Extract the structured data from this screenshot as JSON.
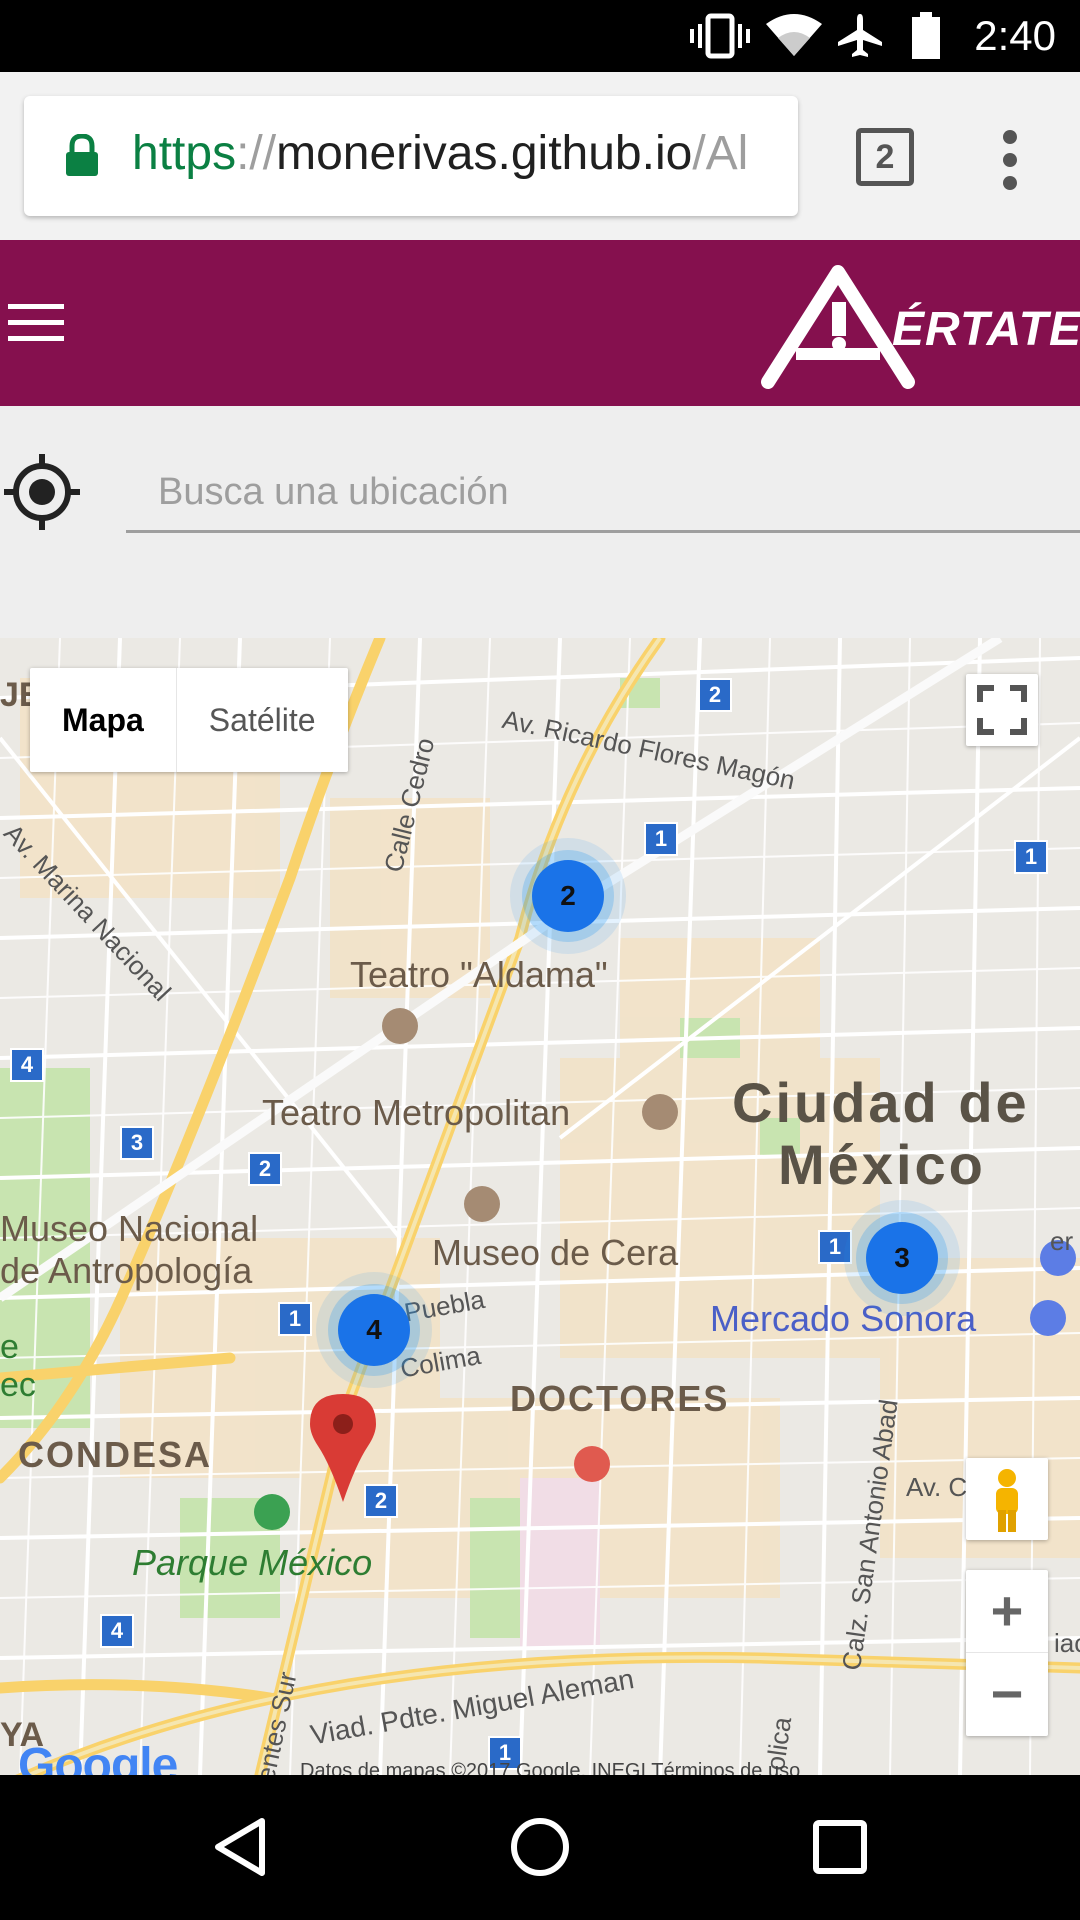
{
  "status_bar": {
    "time": "2:40",
    "icons": [
      "vibrate-icon",
      "wifi-icon",
      "airplane-icon",
      "battery-icon"
    ]
  },
  "browser": {
    "url_scheme": "https",
    "url_separator": "://",
    "url_host": "monerivas.github.io",
    "url_path": "/Al",
    "tab_count": "2"
  },
  "app_header": {
    "logo_text": "ÉRTATE",
    "accent_color": "#85104e"
  },
  "search": {
    "placeholder": "Busca una ubicación"
  },
  "map": {
    "map_type": {
      "map_label": "Mapa",
      "satellite_label": "Satélite",
      "selected": "Mapa"
    },
    "clusters": [
      {
        "count": "2"
      },
      {
        "count": "4"
      },
      {
        "count": "3"
      }
    ],
    "labels": {
      "ciudad_1": "Ciudad de",
      "ciudad_2": "México",
      "teatro_aldama": "Teatro \"Aldama\"",
      "teatro_metropolitan": "Teatro Metropolitan",
      "museo_nacional_1": "Museo Nacional",
      "museo_nacional_2": "de Antropología",
      "museo_cera": "Museo de Cera",
      "mercado_sonora": "Mercado Sonora",
      "doctores": "DOCTORES",
      "condesa": "CONDESA",
      "parque_mexico": "Parque México",
      "av_ricardo": "Av. Ricardo Flores Magón",
      "calle_cedro": "Calle Cedro",
      "av_marina": "Av. Marina Nacional",
      "puebla": "Puebla",
      "colima": "Colima",
      "calz_san_antonio": "Calz. San Antonio Abad",
      "viad_miguel": "Viad. Pdte. Miguel Aleman",
      "insurgentes": "entes Sur",
      "edge_je": "JE",
      "edge_e": "e",
      "edge_ec": "ec",
      "edge_ya": "YA",
      "edge_av_c": "Av. C",
      "edge_er": "er",
      "edge_olica": "olica",
      "edge_iac": "iac"
    },
    "route_shields": [
      "2",
      "1",
      "1",
      "4",
      "3",
      "2",
      "1",
      "1",
      "2",
      "4",
      "1"
    ],
    "google_logo": "Google",
    "attribution": "Datos de mapas ©2017 Google, INEGI    Términos de uso"
  }
}
